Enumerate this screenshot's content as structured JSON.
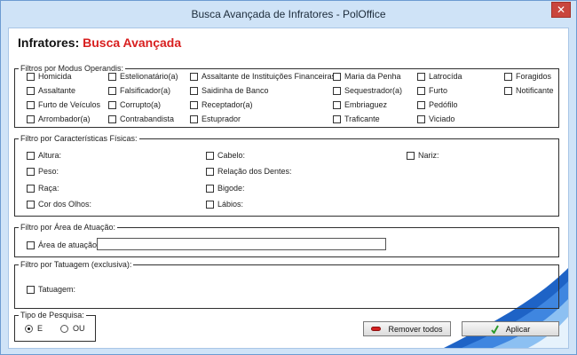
{
  "window": {
    "title": "Busca Avançada de Infratores - PolOffice",
    "close_glyph": "✕"
  },
  "header": {
    "prefix": "Infratores:",
    "title": "Busca Avançada"
  },
  "modus": {
    "legend": "Filtros por Modus Operandis:",
    "items": [
      "Homicida",
      "Estelionatário(a)",
      "Assaltante de Instituições Financeiras",
      "Maria da Penha",
      "Latrocída",
      "Foragidos",
      "Assaltante",
      "Falsificador(a)",
      "Saidinha de Banco",
      "Sequestrador(a)",
      "Furto",
      "Notificante",
      "Furto de Veículos",
      "Corrupto(a)",
      "Receptador(a)",
      "Embriaguez",
      "Pedófilo",
      "Arrombador(a)",
      "Contrabandista",
      "Estuprador",
      "Traficante",
      "Viciado"
    ]
  },
  "fisicas": {
    "legend": "Filtro por Características Físicas:",
    "items": [
      "Altura:",
      "Cabelo:",
      "Nariz:",
      "Peso:",
      "Relação dos Dentes:",
      "Raça:",
      "Bigode:",
      "Cor dos Olhos:",
      "Lábios:"
    ]
  },
  "area": {
    "legend": "Filtro por Área de Atuação:",
    "label": "Área de atuação:",
    "value": ""
  },
  "tatuagem": {
    "legend": "Filtro por Tatuagem (exclusiva):",
    "label": "Tatuagem:"
  },
  "tipo": {
    "legend": "Tipo de Pesquisa:",
    "options": [
      "E",
      "OU"
    ],
    "selected": "E"
  },
  "buttons": {
    "remover": "Remover todos",
    "aplicar": "Aplicar"
  }
}
